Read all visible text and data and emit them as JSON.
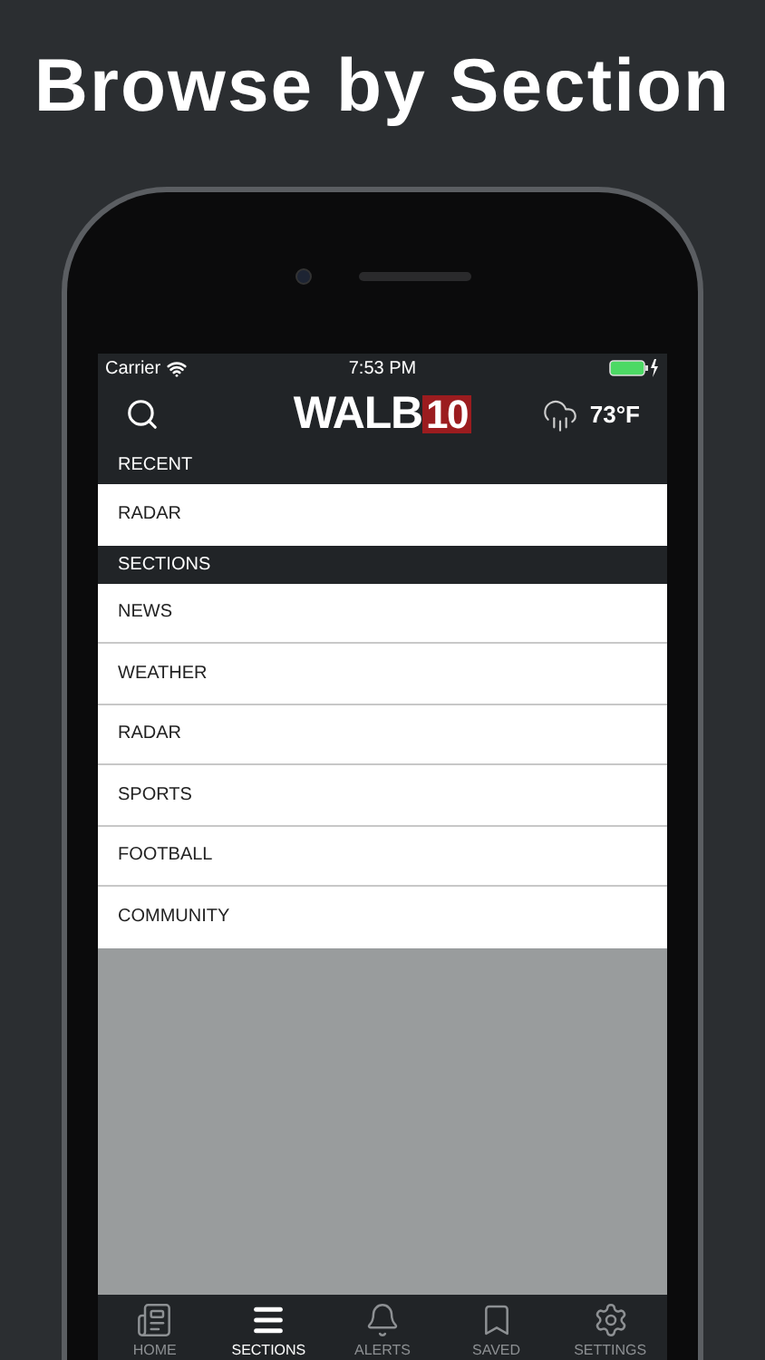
{
  "headline": "Browse by Section",
  "status_bar": {
    "carrier": "Carrier",
    "time": "7:53 PM"
  },
  "header": {
    "logo_text": "WALB",
    "logo_badge": "10",
    "temperature": "73°F"
  },
  "groups": [
    {
      "title": "RECENT",
      "items": [
        "RADAR"
      ]
    },
    {
      "title": "SECTIONS",
      "items": [
        "NEWS",
        "WEATHER",
        "RADAR",
        "SPORTS",
        "FOOTBALL",
        "COMMUNITY"
      ]
    }
  ],
  "tabs": [
    {
      "label": "HOME",
      "kind": "home",
      "selected": false
    },
    {
      "label": "SECTIONS",
      "kind": "sections",
      "selected": true
    },
    {
      "label": "ALERTS",
      "kind": "alerts",
      "selected": false
    },
    {
      "label": "SAVED",
      "kind": "saved",
      "selected": false
    },
    {
      "label": "SETTINGS",
      "kind": "settings",
      "selected": false
    }
  ]
}
